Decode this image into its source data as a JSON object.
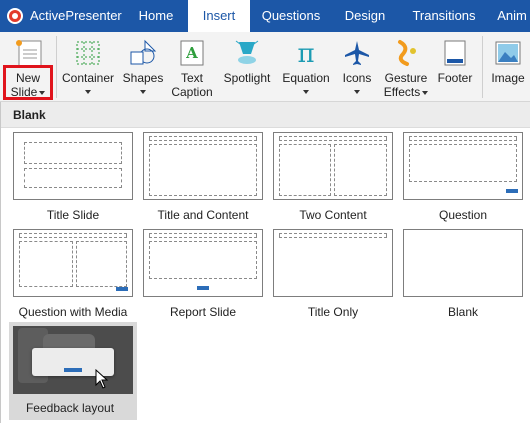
{
  "app": {
    "title": "ActivePresenter"
  },
  "tabs": [
    {
      "label": "Home",
      "active": false
    },
    {
      "label": "Insert",
      "active": true
    },
    {
      "label": "Questions",
      "active": false
    },
    {
      "label": "Design",
      "active": false
    },
    {
      "label": "Transitions",
      "active": false
    },
    {
      "label": "Anim",
      "active": false
    }
  ],
  "ribbon": {
    "new_slide": {
      "line1": "New",
      "line2": "Slide"
    },
    "container": {
      "label": "Container"
    },
    "shapes": {
      "label": "Shapes"
    },
    "text_caption": {
      "line1": "Text",
      "line2": "Caption"
    },
    "spotlight": {
      "label": "Spotlight"
    },
    "equation": {
      "label": "Equation"
    },
    "icons": {
      "label": "Icons"
    },
    "gesture_effects": {
      "line1": "Gesture",
      "line2": "Effects"
    },
    "footer": {
      "label": "Footer"
    },
    "image": {
      "label": "Image"
    }
  },
  "gallery": {
    "header": "Blank",
    "layouts": [
      {
        "label": "Title Slide"
      },
      {
        "label": "Title and Content"
      },
      {
        "label": "Two Content"
      },
      {
        "label": "Question"
      },
      {
        "label": "Question with Media"
      },
      {
        "label": "Report Slide"
      },
      {
        "label": "Title Only"
      },
      {
        "label": "Blank"
      },
      {
        "label": "Feedback layout"
      }
    ]
  },
  "colors": {
    "tab_bar": "#1c57a7",
    "highlight_box": "#e0141c",
    "question_bar": "#2c6db8"
  }
}
